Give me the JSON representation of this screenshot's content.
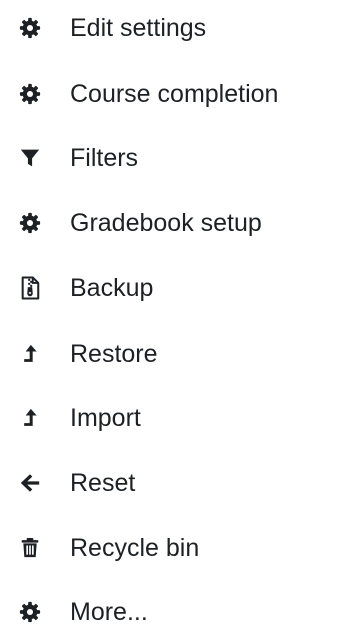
{
  "menu": {
    "items": [
      {
        "label": "Edit settings",
        "icon": "gear-icon"
      },
      {
        "label": "Course completion",
        "icon": "gear-icon"
      },
      {
        "label": "Filters",
        "icon": "filter-icon"
      },
      {
        "label": "Gradebook setup",
        "icon": "gear-icon"
      },
      {
        "label": "Backup",
        "icon": "file-archive-icon"
      },
      {
        "label": "Restore",
        "icon": "level-up-icon"
      },
      {
        "label": "Import",
        "icon": "level-up-icon"
      },
      {
        "label": "Reset",
        "icon": "arrow-left-icon"
      },
      {
        "label": "Recycle bin",
        "icon": "trash-icon"
      },
      {
        "label": "More...",
        "icon": "gear-icon"
      }
    ]
  },
  "colors": {
    "text": "#1d2125",
    "icon": "#1d2125",
    "background": "#ffffff"
  }
}
